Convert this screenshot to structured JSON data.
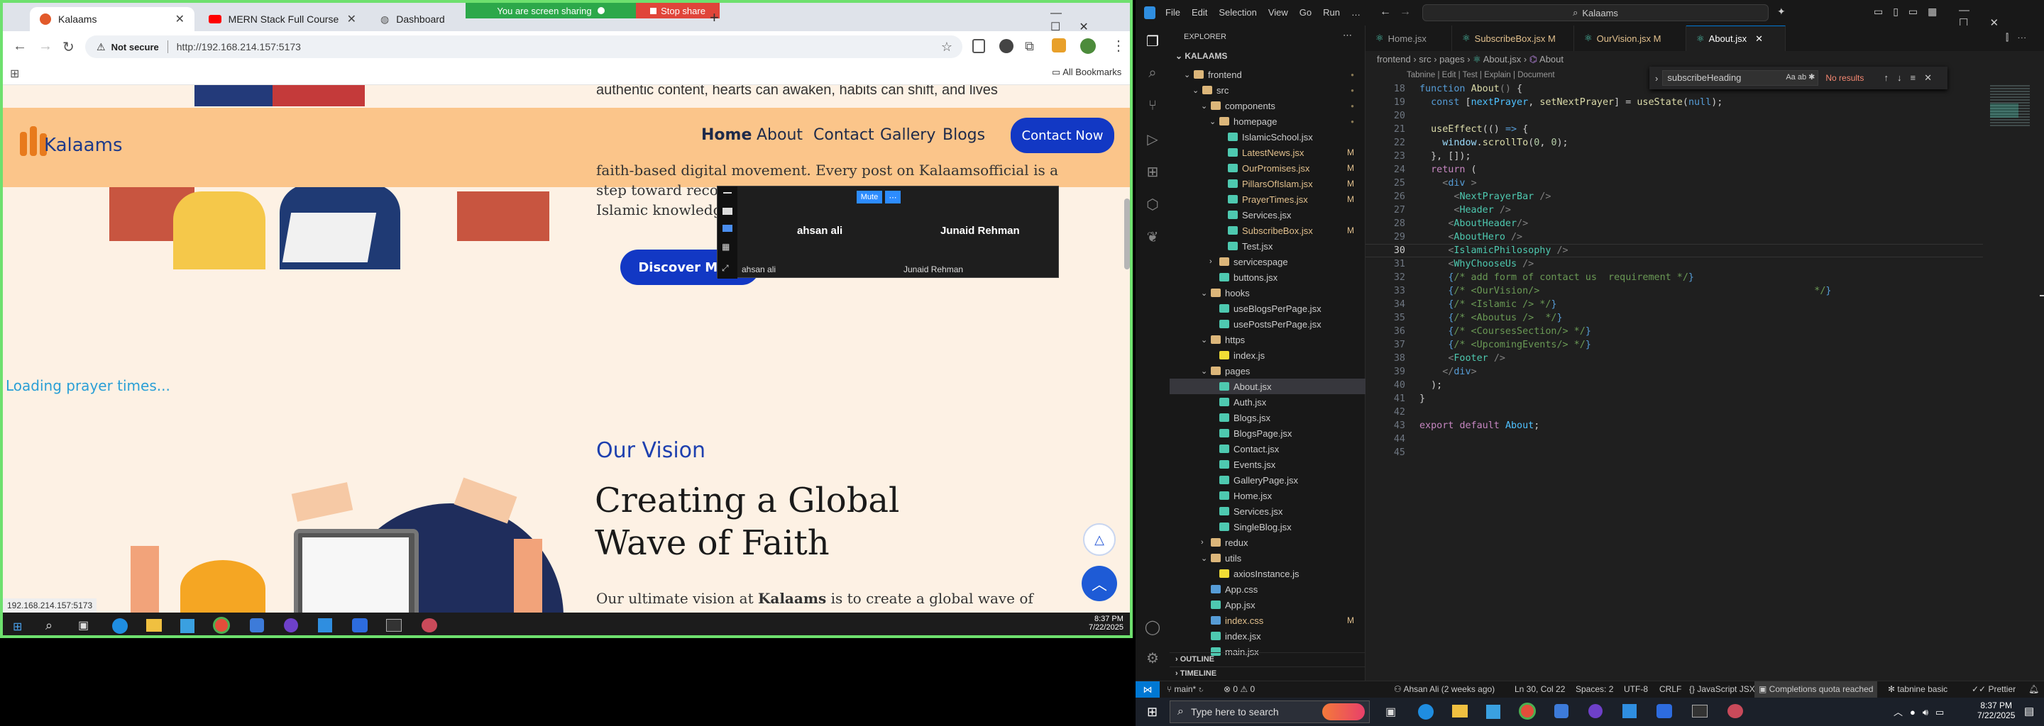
{
  "browser": {
    "tabs": [
      {
        "label": "Kalaams",
        "active": true
      },
      {
        "label": "MERN Stack Full Course - ECom",
        "active": false
      },
      {
        "label": "Dashboard",
        "active": false
      }
    ],
    "sharing_label": "You are screen sharing",
    "stop_share_label": "Stop share",
    "not_secure": "Not secure",
    "url": "http://192.168.214.157:5173",
    "all_bookmarks": "All Bookmarks",
    "status_url": "192.168.214.157:5173"
  },
  "site": {
    "brand": "Kalaams",
    "nav": [
      "Home",
      "About",
      "Contact",
      "Gallery",
      "Blogs"
    ],
    "cta": "Contact Now",
    "text_top": "authentic content, hearts can awaken, habits can shift, and lives",
    "text_line1": "faith-based digital movement. Every post on Kalaamsofficial is a",
    "text_line2": "step toward reconn",
    "text_line3": "Islamic knowledge",
    "discover": "Discover More",
    "loading": "Loading prayer times...",
    "vision_label": "Our Vision",
    "heading_line1": "Creating a Global",
    "heading_line2": "Wave of Faith",
    "body_prefix": "Our ultimate vision at ",
    "body_brand": "Kalaams",
    "body_suffix": " is to create a global wave of"
  },
  "meeting": {
    "mute_label": "Mute",
    "more_label": "⋯",
    "participant1": "ahsan ali",
    "participant2": "Junaid Rehman"
  },
  "left_taskbar": {
    "time": "8:37 PM",
    "date": "7/22/2025"
  },
  "vscode": {
    "search": "Kalaams",
    "menu": [
      "File",
      "Edit",
      "Selection",
      "View",
      "Go",
      "Run",
      "…"
    ],
    "explorer_title": "EXPLORER",
    "root": "KALAAMS",
    "tree": [
      {
        "label": "frontend",
        "indent": 1,
        "kind": "folder-open",
        "mark": "dot"
      },
      {
        "label": "src",
        "indent": 2,
        "kind": "folder-open",
        "mark": "dot"
      },
      {
        "label": "components",
        "indent": 3,
        "kind": "folder-open",
        "mark": "dot"
      },
      {
        "label": "homepage",
        "indent": 4,
        "kind": "folder-open",
        "mark": "dot"
      },
      {
        "label": "IslamicSchool.jsx",
        "indent": 5,
        "kind": "file",
        "mark": ""
      },
      {
        "label": "LatestNews.jsx",
        "indent": 5,
        "kind": "file-mod",
        "mark": "M"
      },
      {
        "label": "OurPromises.jsx",
        "indent": 5,
        "kind": "file-mod",
        "mark": "M"
      },
      {
        "label": "PillarsOfIslam.jsx",
        "indent": 5,
        "kind": "file-mod",
        "mark": "M"
      },
      {
        "label": "PrayerTimes.jsx",
        "indent": 5,
        "kind": "file-mod",
        "mark": "M"
      },
      {
        "label": "Services.jsx",
        "indent": 5,
        "kind": "file",
        "mark": ""
      },
      {
        "label": "SubscribeBox.jsx",
        "indent": 5,
        "kind": "file-mod",
        "mark": "M"
      },
      {
        "label": "Test.jsx",
        "indent": 5,
        "kind": "file",
        "mark": ""
      },
      {
        "label": "servicespage",
        "indent": 4,
        "kind": "folder",
        "mark": ""
      },
      {
        "label": "buttons.jsx",
        "indent": 4,
        "kind": "file",
        "mark": ""
      },
      {
        "label": "hooks",
        "indent": 3,
        "kind": "folder-open",
        "mark": ""
      },
      {
        "label": "useBlogsPerPage.jsx",
        "indent": 4,
        "kind": "file",
        "mark": ""
      },
      {
        "label": "usePostsPerPage.jsx",
        "indent": 4,
        "kind": "file",
        "mark": ""
      },
      {
        "label": "https",
        "indent": 3,
        "kind": "folder-open",
        "mark": ""
      },
      {
        "label": "index.js",
        "indent": 4,
        "kind": "js",
        "mark": ""
      },
      {
        "label": "pages",
        "indent": 3,
        "kind": "folder-open",
        "mark": ""
      },
      {
        "label": "About.jsx",
        "indent": 4,
        "kind": "file-sel",
        "mark": ""
      },
      {
        "label": "Auth.jsx",
        "indent": 4,
        "kind": "file",
        "mark": ""
      },
      {
        "label": "Blogs.jsx",
        "indent": 4,
        "kind": "file",
        "mark": ""
      },
      {
        "label": "BlogsPage.jsx",
        "indent": 4,
        "kind": "file",
        "mark": ""
      },
      {
        "label": "Contact.jsx",
        "indent": 4,
        "kind": "file",
        "mark": ""
      },
      {
        "label": "Events.jsx",
        "indent": 4,
        "kind": "file",
        "mark": ""
      },
      {
        "label": "GalleryPage.jsx",
        "indent": 4,
        "kind": "file",
        "mark": ""
      },
      {
        "label": "Home.jsx",
        "indent": 4,
        "kind": "file",
        "mark": ""
      },
      {
        "label": "Services.jsx",
        "indent": 4,
        "kind": "file",
        "mark": ""
      },
      {
        "label": "SingleBlog.jsx",
        "indent": 4,
        "kind": "file",
        "mark": ""
      },
      {
        "label": "redux",
        "indent": 3,
        "kind": "folder",
        "mark": ""
      },
      {
        "label": "utils",
        "indent": 3,
        "kind": "folder-open",
        "mark": ""
      },
      {
        "label": "axiosInstance.js",
        "indent": 4,
        "kind": "js",
        "mark": ""
      },
      {
        "label": "App.css",
        "indent": 3,
        "kind": "css",
        "mark": ""
      },
      {
        "label": "App.jsx",
        "indent": 3,
        "kind": "file",
        "mark": ""
      },
      {
        "label": "index.css",
        "indent": 3,
        "kind": "css-mod",
        "mark": "M"
      },
      {
        "label": "index.jsx",
        "indent": 3,
        "kind": "file",
        "mark": ""
      },
      {
        "label": "main.jsx",
        "indent": 3,
        "kind": "file",
        "mark": ""
      }
    ],
    "outline": "OUTLINE",
    "timeline": "TIMELINE",
    "tabs": [
      {
        "label": "Home.jsx",
        "mark": "",
        "active": false
      },
      {
        "label": "SubscribeBox.jsx",
        "mark": "M",
        "active": false
      },
      {
        "label": "OurVision.jsx",
        "mark": "M",
        "active": false
      },
      {
        "label": "About.jsx",
        "mark": "",
        "active": true
      }
    ],
    "breadcrumb": [
      "frontend",
      "src",
      "pages",
      "About.jsx",
      "About"
    ],
    "codelens": "Tabnine | Edit | Test | Explain | Document",
    "find_value": "subscribeHeading",
    "find_result": "No results",
    "code_lines": [
      {
        "n": "18",
        "html": "<span class='kw'>function</span> <span class='fn'>About</span><span class='pn'>()</span> {"
      },
      {
        "n": "19",
        "html": "  <span class='kw'>const</span> [<span class='cls'>nextPrayer</span>, <span class='fn'>setNextPrayer</span>] = <span class='fn'>useState</span>(<span class='kw'>null</span>);"
      },
      {
        "n": "20",
        "html": ""
      },
      {
        "n": "21",
        "html": "  <span class='fn'>useEffect</span>(() <span class='kw'>=&gt;</span> {"
      },
      {
        "n": "22",
        "html": "    <span class='var'>window</span>.<span class='fn'>scrollTo</span>(<span class='num'>0</span>, <span class='num'>0</span>);"
      },
      {
        "n": "23",
        "html": "  }, []);"
      },
      {
        "n": "24",
        "html": "  <span class='kc'>return</span> ("
      },
      {
        "n": "25",
        "html": "    <span class='pn'>&lt;</span><span class='kw'>div</span> <span class='pn'>&gt;</span>"
      },
      {
        "n": "26",
        "html": "      <span class='pn'>&lt;</span><span class='tag'>NextPrayerBar</span> <span class='pn'>/&gt;</span>"
      },
      {
        "n": "27",
        "html": "      <span class='pn'>&lt;</span><span class='tag'>Header</span> <span class='pn'>/&gt;</span>"
      },
      {
        "n": "28",
        "html": "     <span class='pn'>&lt;</span><span class='tag'>AboutHeader</span><span class='pn'>/&gt;</span>"
      },
      {
        "n": "29",
        "html": "     <span class='pn'>&lt;</span><span class='tag'>AboutHero</span> <span class='pn'>/&gt;</span>"
      },
      {
        "n": "30",
        "html": "     <span class='pn'>&lt;</span><span class='tag'>IslamicPhilosophy</span> <span class='pn'>/&gt;</span>"
      },
      {
        "n": "31",
        "html": "     <span class='pn'>&lt;</span><span class='tag'>WhyChooseUs</span> <span class='pn'>/&gt;</span>"
      },
      {
        "n": "32",
        "html": "     <span class='kw'>{</span><span class='cm'>/* add form of contact us  requirement */</span><span class='kw'>}</span>"
      },
      {
        "n": "33",
        "html": "     <span class='kw'>{</span><span class='cm'>/* &lt;OurVision/&gt;                                                */</span><span class='kw'>}</span>"
      },
      {
        "n": "34",
        "html": "     <span class='kw'>{</span><span class='cm'>/* &lt;Islamic /&gt; */</span><span class='kw'>}</span>"
      },
      {
        "n": "35",
        "html": "     <span class='kw'>{</span><span class='cm'>/* &lt;Aboutus /&gt;  */</span><span class='kw'>}</span>"
      },
      {
        "n": "36",
        "html": "     <span class='kw'>{</span><span class='cm'>/* &lt;CoursesSection/&gt; */</span><span class='kw'>}</span>"
      },
      {
        "n": "37",
        "html": "     <span class='kw'>{</span><span class='cm'>/* &lt;UpcomingEvents/&gt; */</span><span class='kw'>}</span>"
      },
      {
        "n": "38",
        "html": "     <span class='pn'>&lt;</span><span class='tag'>Footer</span> <span class='pn'>/&gt;</span>"
      },
      {
        "n": "39",
        "html": "    <span class='pn'>&lt;/</span><span class='kw'>div</span><span class='pn'>&gt;</span>"
      },
      {
        "n": "40",
        "html": "  );"
      },
      {
        "n": "41",
        "html": "}"
      },
      {
        "n": "42",
        "html": ""
      },
      {
        "n": "43",
        "html": "<span class='kc'>export</span> <span class='kc'>default</span> <span class='cls'>About</span>;"
      },
      {
        "n": "44",
        "html": ""
      },
      {
        "n": "45",
        "html": ""
      }
    ],
    "status": {
      "branch": "main*",
      "problems": "⊗ 0 ⚠ 0",
      "blame": "Ahsan Ali (2 weeks ago)",
      "position": "Ln 30, Col 22",
      "spaces": "Spaces: 2",
      "encoding": "UTF-8",
      "eol": "CRLF",
      "language": "JavaScript JSX",
      "quota": "Completions quota reached",
      "tabnine": "tabnine basic",
      "prettier": "Prettier"
    }
  },
  "win_taskbar": {
    "search_placeholder": "Type here to search",
    "time": "8:37 PM",
    "date": "7/22/2025"
  }
}
